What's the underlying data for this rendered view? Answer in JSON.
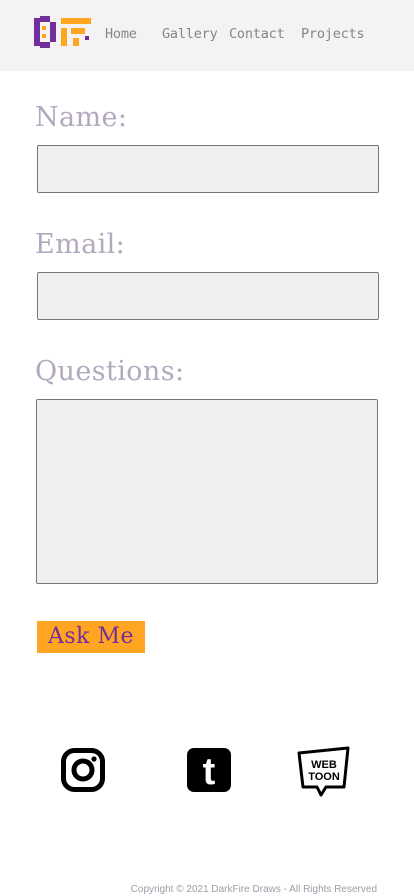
{
  "nav": {
    "logo": {
      "text": "DF",
      "colors": [
        "#722e9a",
        "#ffa521"
      ]
    },
    "links": [
      {
        "label": "Home"
      },
      {
        "label": "Gallery"
      },
      {
        "label": "Contact"
      },
      {
        "label": "Projects"
      }
    ]
  },
  "form": {
    "name_label": "Name:",
    "name_value": "",
    "email_label": "Email:",
    "email_value": "",
    "questions_label": "Questions:",
    "questions_value": "",
    "submit_label": "Ask Me"
  },
  "social": [
    {
      "name": "instagram",
      "icon": "instagram-icon"
    },
    {
      "name": "tumblr",
      "icon": "tumblr-icon",
      "glyph": "t"
    },
    {
      "name": "webtoon",
      "icon": "webtoon-icon",
      "lines": [
        "WEB",
        "TOON"
      ]
    }
  ],
  "footer": {
    "copyright": "Copyright © 2021 DarkFire Draws - All Rights Reserved"
  },
  "colors": {
    "navbar_bg": "#f3f3f3",
    "label": "#b3a9bf",
    "button_bg": "#ffa521",
    "button_text": "#722e9a",
    "purple": "#722e9a",
    "orange": "#ffa521"
  }
}
